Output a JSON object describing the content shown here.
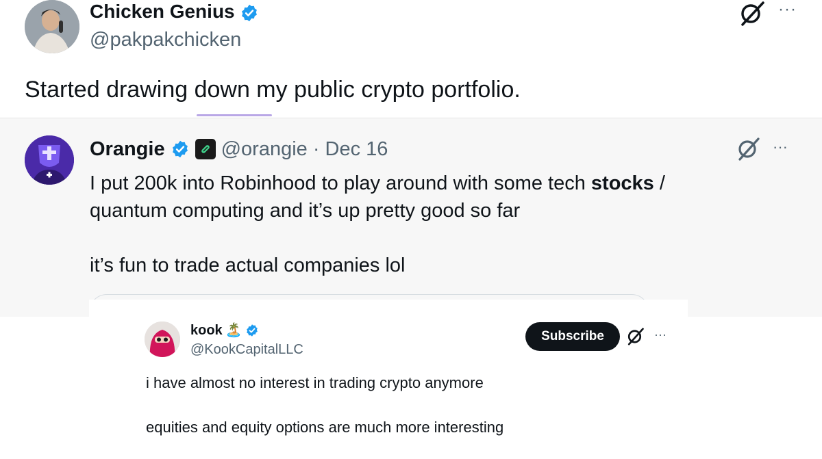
{
  "main_tweet": {
    "author_name": "Chicken Genius",
    "handle": "@pakpakchicken",
    "text": "Started drawing down my public crypto portfolio.",
    "more_label": "···"
  },
  "quoted_tweet": {
    "author_name": "Orangie",
    "handle_date": "@orangie · Dec 16",
    "text_line1_pre": "I put 200k into Robinhood to play around with some tech ",
    "text_line1_bold": "stocks",
    "text_line1_post": " /",
    "text_line2": "quantum computing and it’s up pretty good so far",
    "text_line3": "it’s fun to trade actual companies lol",
    "more_label": "···"
  },
  "overlay_tweet": {
    "author_name": "kook",
    "name_emoji": "🏝️",
    "handle": "@KookCapitalLLC",
    "subscribe_label": "Subscribe",
    "text_line1": "i have almost no interest in trading crypto anymore",
    "text_line2": "equities and equity options are much more interesting",
    "more_label": "···"
  },
  "colors": {
    "verified_blue": "#1d9bf0",
    "secondary_text": "#536471",
    "quote_background": "#f7f7f7"
  },
  "icons": [
    "verified-badge-icon",
    "grok-icon",
    "more-icon",
    "island-emoji-icon",
    "affiliate-badge-icon"
  ]
}
